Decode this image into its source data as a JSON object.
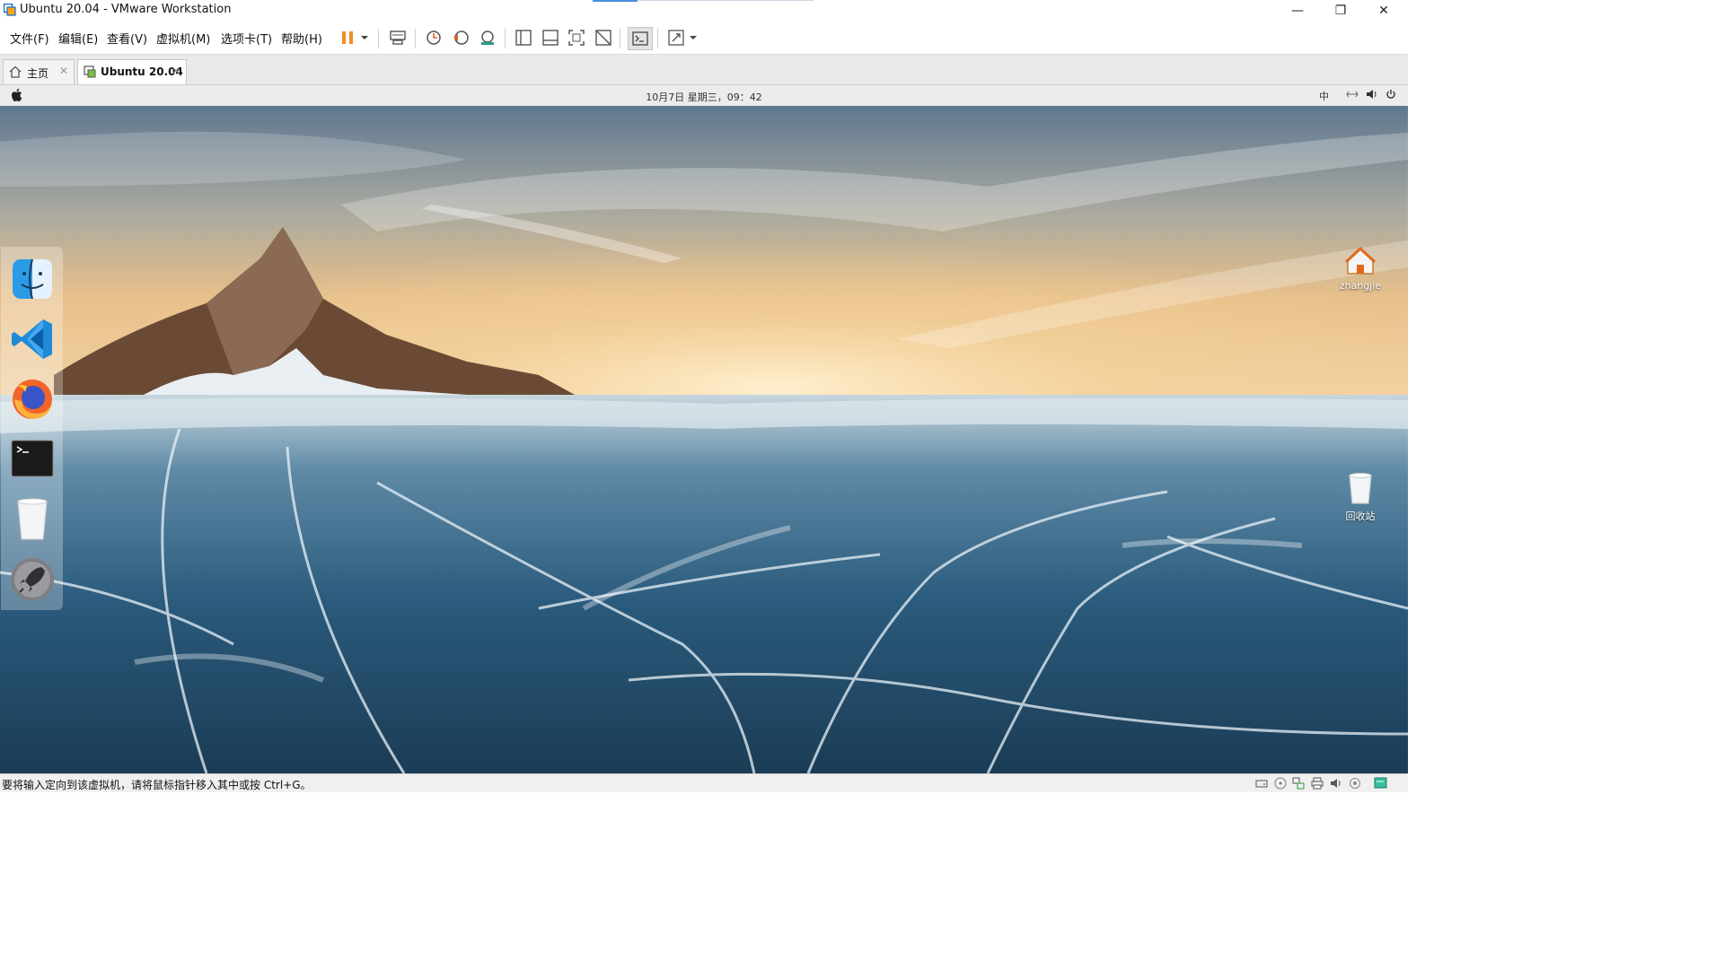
{
  "window": {
    "title": "Ubuntu 20.04 - VMware Workstation",
    "controls": {
      "minimize": "—",
      "restore": "❐",
      "close": "✕"
    }
  },
  "menu": {
    "items": [
      "文件(F)",
      "编辑(E)",
      "查看(V)",
      "虚拟机(M)",
      "选项卡(T)",
      "帮助(H)"
    ]
  },
  "toolbar": {
    "buttons": [
      "pause-icon",
      "send-ctrl-alt-del-icon",
      "snapshot-icon",
      "revert-snapshot-icon",
      "snapshot-manager-icon",
      "library-view-icon",
      "thumbnail-bar-icon",
      "full-screen-icon",
      "unity-icon",
      "console-view-icon",
      "stretch-guest-icon"
    ],
    "accent_color": "#f28c28"
  },
  "tabs": [
    {
      "label": "主页",
      "active": false
    },
    {
      "label": "Ubuntu 20.04",
      "active": true
    }
  ],
  "vm_panel": {
    "clock": "10月7日 星期三，09：42",
    "input_method": "中"
  },
  "desktop": {
    "icons": [
      {
        "label": "zhangjie",
        "icon": "home-folder-icon"
      },
      {
        "label": "回收站",
        "icon": "trash-icon"
      }
    ]
  },
  "dock": {
    "items": [
      "finder-icon",
      "vscode-icon",
      "firefox-icon",
      "terminal-icon",
      "trash-icon",
      "launchpad-icon"
    ]
  },
  "statusbar": {
    "message": "要将输入定向到该虚拟机，请将鼠标指针移入其中或按 Ctrl+G。",
    "icons": [
      "hard-disk-icon",
      "cd-drive-icon",
      "network-icon",
      "printer-icon",
      "sound-icon",
      "usb-icon",
      "message-icon"
    ]
  }
}
